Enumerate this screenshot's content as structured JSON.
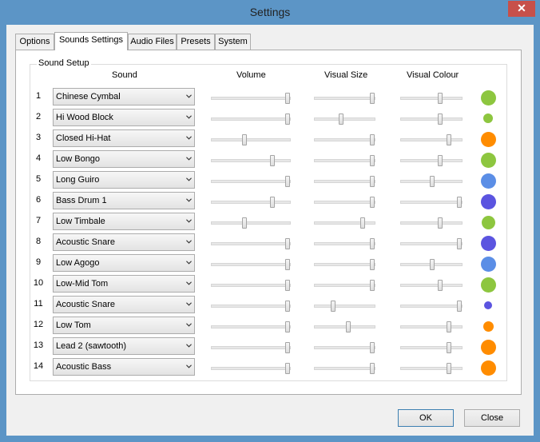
{
  "window": {
    "title": "Settings",
    "close_glyph": "✕"
  },
  "tabs": [
    {
      "label": "Options"
    },
    {
      "label": "Sounds Settings",
      "active": true
    },
    {
      "label": "Audio Files"
    },
    {
      "label": "Presets"
    },
    {
      "label": "System"
    }
  ],
  "group": {
    "label": "Sound Setup",
    "columns": {
      "sound": "Sound",
      "volume": "Volume",
      "visual_size": "Visual Size",
      "visual_colour": "Visual Colour"
    }
  },
  "rows": [
    {
      "num": "1",
      "sound": "Chinese Cymbal",
      "volume": 1.0,
      "size": 1.0,
      "colour": 0.66,
      "dot_color": "#8dc63f"
    },
    {
      "num": "2",
      "sound": "Hi Wood Block",
      "volume": 1.0,
      "size": 0.43,
      "colour": 0.66,
      "dot_color": "#8dc63f"
    },
    {
      "num": "3",
      "sound": "Closed Hi-Hat",
      "volume": 0.41,
      "size": 1.0,
      "colour": 0.81,
      "dot_color": "#ff8c00"
    },
    {
      "num": "4",
      "sound": "Low Bongo",
      "volume": 0.79,
      "size": 1.0,
      "colour": 0.66,
      "dot_color": "#8dc63f"
    },
    {
      "num": "5",
      "sound": "Long Guiro",
      "volume": 1.0,
      "size": 1.0,
      "colour": 0.52,
      "dot_color": "#5b8ee6"
    },
    {
      "num": "6",
      "sound": "Bass Drum 1",
      "volume": 0.79,
      "size": 1.0,
      "colour": 1.0,
      "dot_color": "#5b54e0"
    },
    {
      "num": "7",
      "sound": "Low Timbale",
      "volume": 0.41,
      "size": 0.82,
      "colour": 0.66,
      "dot_color": "#8dc63f"
    },
    {
      "num": "8",
      "sound": "Acoustic Snare",
      "volume": 1.0,
      "size": 1.0,
      "colour": 1.0,
      "dot_color": "#5b54e0"
    },
    {
      "num": "9",
      "sound": "Low Agogo",
      "volume": 1.0,
      "size": 1.0,
      "colour": 0.52,
      "dot_color": "#5b8ee6"
    },
    {
      "num": "10",
      "sound": "Low-Mid Tom",
      "volume": 1.0,
      "size": 1.0,
      "colour": 0.66,
      "dot_color": "#8dc63f"
    },
    {
      "num": "11",
      "sound": "Acoustic Snare",
      "volume": 1.0,
      "size": 0.29,
      "colour": 1.0,
      "dot_color": "#5b54e0"
    },
    {
      "num": "12",
      "sound": "Low Tom",
      "volume": 1.0,
      "size": 0.57,
      "colour": 0.81,
      "dot_color": "#ff8c00"
    },
    {
      "num": "13",
      "sound": "Lead 2 (sawtooth)",
      "volume": 1.0,
      "size": 1.0,
      "colour": 0.81,
      "dot_color": "#ff8c00"
    },
    {
      "num": "14",
      "sound": "Acoustic Bass",
      "volume": 1.0,
      "size": 1.0,
      "colour": 0.81,
      "dot_color": "#ff8c00"
    }
  ],
  "buttons": {
    "ok": "OK",
    "close": "Close"
  }
}
